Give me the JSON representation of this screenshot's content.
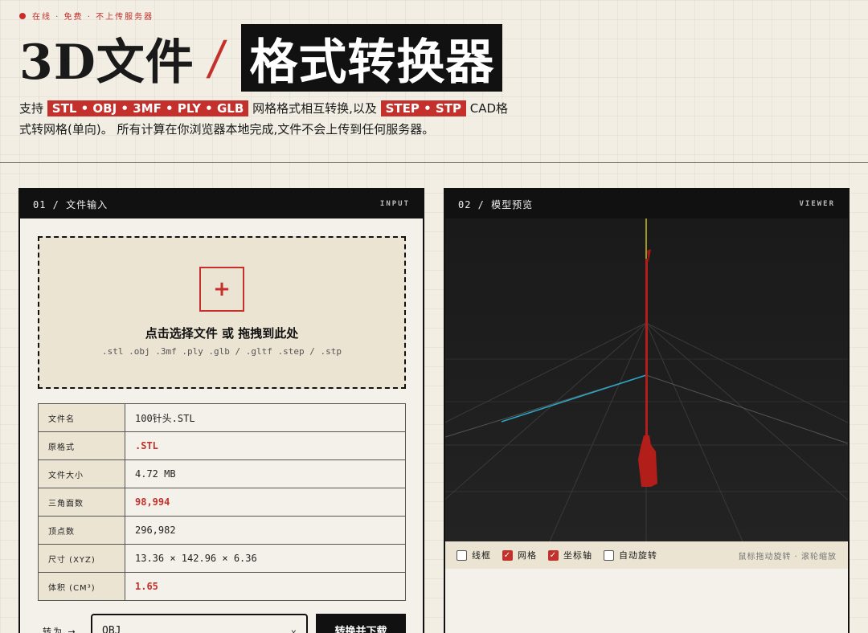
{
  "status": "在线 · 免费 · 不上传服务器",
  "title": {
    "part1": "3D文件",
    "slash": "/",
    "part2": "格式转换器"
  },
  "desc": {
    "t1": "支持",
    "tag1": "STL • OBJ • 3MF • PLY • GLB",
    "t2": "网格格式相互转换,以及",
    "tag2": "STEP • STP",
    "t3": "CAD格式转网格(单向)。 所有计算在你浏览器本地完成,文件不会上传到任何服务器。"
  },
  "input_panel": {
    "header_left": "01 / 文件输入",
    "header_right": "INPUT",
    "drop_plus": "+",
    "drop_title": "点击选择文件 或 拖拽到此处",
    "drop_formats": ".stl .obj .3mf .ply .glb / .gltf .step / .stp",
    "info": [
      {
        "key": "文件名",
        "value": "100针头.STL"
      },
      {
        "key": "原格式",
        "value": ".STL"
      },
      {
        "key": "文件大小",
        "value": "4.72 MB"
      },
      {
        "key": "三角面数",
        "value": "98,994"
      },
      {
        "key": "顶点数",
        "value": "296,982"
      },
      {
        "key": "尺寸 (XYZ)",
        "value": "13.36 × 142.96 × 6.36"
      },
      {
        "key": "体积 (CM³)",
        "value": "1.65"
      }
    ],
    "convert_label": "转为 →",
    "convert_value": "OBJ",
    "convert_button": "转换并下载"
  },
  "viewer_panel": {
    "header_left": "02 / 模型预览",
    "header_right": "VIEWER",
    "options": [
      {
        "label": "线框",
        "checked": false
      },
      {
        "label": "网格",
        "checked": true
      },
      {
        "label": "坐标轴",
        "checked": true
      },
      {
        "label": "自动旋转",
        "checked": false
      }
    ],
    "hint": "鼠标拖动旋转 · 滚轮缩放"
  },
  "colors": {
    "accent": "#c4302b",
    "dark": "#111111",
    "paper": "#f2eee4"
  }
}
